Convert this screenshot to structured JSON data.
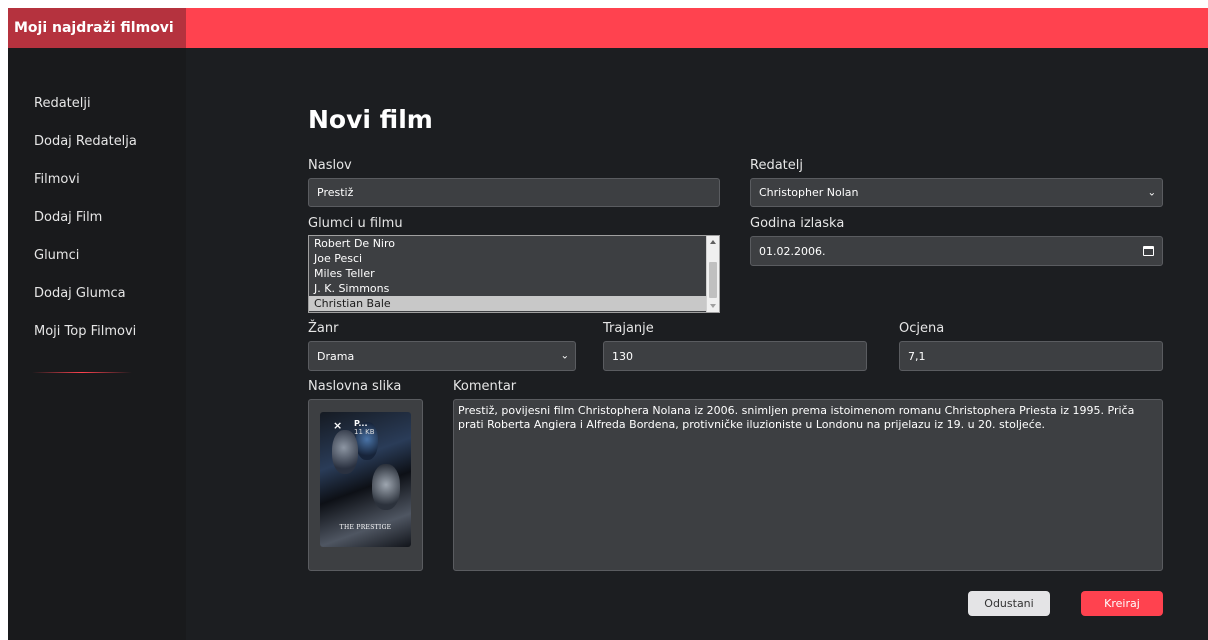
{
  "app": {
    "brand": "Moji najdraži filmovi"
  },
  "sidebar": {
    "items": [
      {
        "label": "Redatelji"
      },
      {
        "label": "Dodaj Redatelja"
      },
      {
        "label": "Filmovi"
      },
      {
        "label": "Dodaj Film"
      },
      {
        "label": "Glumci"
      },
      {
        "label": "Dodaj Glumca"
      },
      {
        "label": "Moji Top Filmovi"
      }
    ]
  },
  "form": {
    "title": "Novi film",
    "naslov": {
      "label": "Naslov",
      "value": "Prestiž"
    },
    "redatelj": {
      "label": "Redatelj",
      "value": "Christopher Nolan"
    },
    "glumci": {
      "label": "Glumci u filmu",
      "options": [
        "Robert De Niro",
        "Joe Pesci",
        "Miles Teller",
        "J. K. Simmons",
        "Christian Bale"
      ],
      "selected": "Christian Bale"
    },
    "godina": {
      "label": "Godina izlaska",
      "value": "01.02.2006."
    },
    "zanr": {
      "label": "Žanr",
      "value": "Drama"
    },
    "trajanje": {
      "label": "Trajanje",
      "value": "130"
    },
    "ocjena": {
      "label": "Ocjena",
      "value": "7,1"
    },
    "slika": {
      "label": "Naslovna slika",
      "remove_glyph": "×",
      "preview_letter": "P...",
      "file_size": "11 KB",
      "poster_text": "THE PRESTIGE"
    },
    "komentar": {
      "label": "Komentar",
      "value": "Prestiž, povijesni film Christophera Nolana iz 2006. snimljen prema istoimenom romanu Christophera Priesta iz 1995. Priča prati Roberta Angiera i Alfreda Bordena, protivničke iluzioniste u Londonu na prijelazu iz 19. u 20. stoljeće."
    },
    "buttons": {
      "cancel": "Odustani",
      "create": "Kreiraj"
    }
  },
  "colors": {
    "accent": "#ff424f",
    "brand_bg": "#b5323e",
    "background": "#1c1e21",
    "field_bg": "#3d3f42"
  }
}
